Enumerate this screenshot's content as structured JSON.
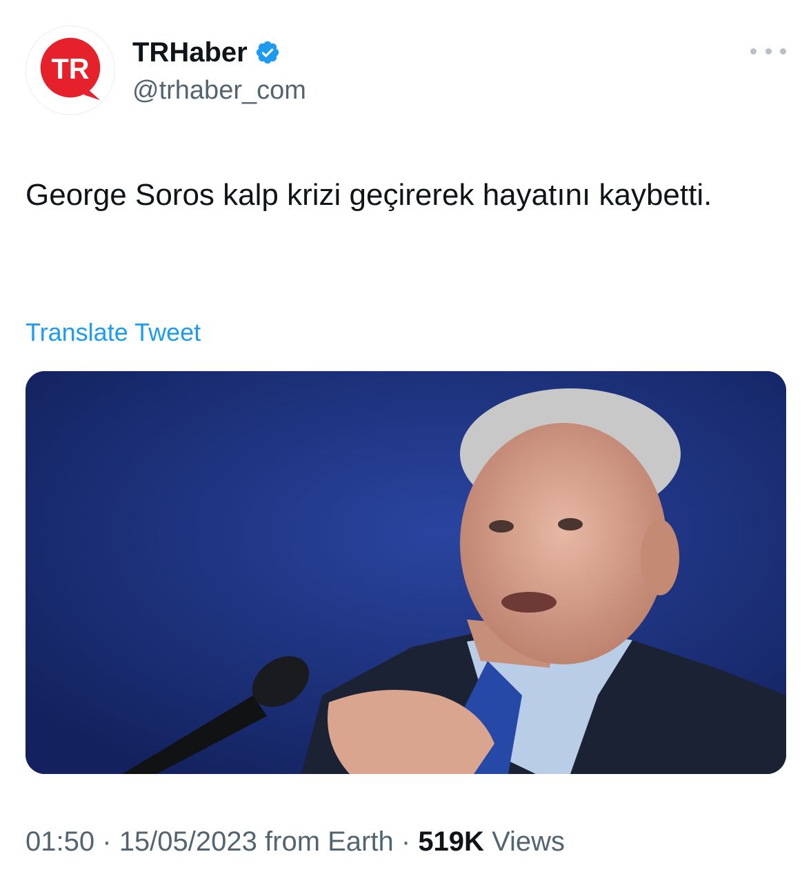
{
  "tweet": {
    "author": {
      "display_name": "TRHaber",
      "handle": "@trhaber_com",
      "verified": true,
      "avatar_icon": "tr-logo-icon",
      "avatar_text": "TR",
      "brand_color": "#e5222b"
    },
    "more_icon": "more-horizontal-icon",
    "text": "George Soros kalp krizi geçirerek hayatını kaybetti.",
    "translate_label": "Translate Tweet",
    "media_icon": "photo-image",
    "meta": {
      "time": "01:50",
      "separator": "·",
      "date": "15/05/2023",
      "source": "from Earth",
      "views_count": "519K",
      "views_label": "Views"
    }
  },
  "colors": {
    "link": "#1d9bf0",
    "secondary_text": "#536471",
    "verified_badge": "#1d9bf0",
    "media_background": "#182d74"
  }
}
